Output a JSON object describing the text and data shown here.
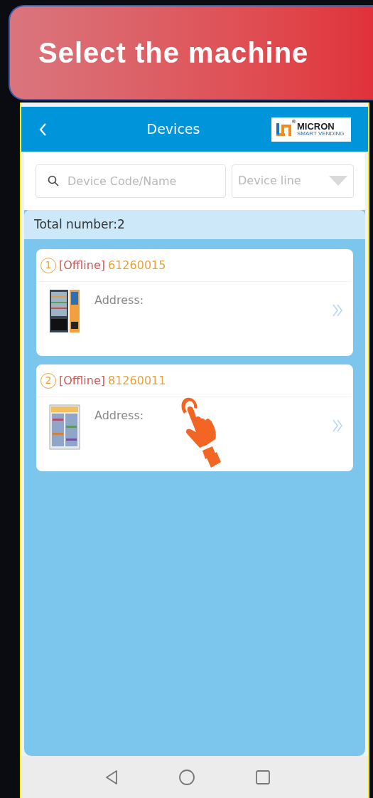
{
  "banner": {
    "title": "Select the machine"
  },
  "header": {
    "title": "Devices",
    "logo": {
      "brand": "MICRON",
      "tagline": "SMART VENDING",
      "mark": "®"
    }
  },
  "search": {
    "placeholder": "Device Code/Name"
  },
  "device_line": {
    "placeholder": "Device line"
  },
  "total": "Total number:2",
  "devices": [
    {
      "index": "1",
      "status": "[Offline]",
      "code": "61260015",
      "address_label": "Address:",
      "kind": "snack",
      "pointer": false
    },
    {
      "index": "2",
      "status": "[Offline]",
      "code": "81260011",
      "address_label": "Address:",
      "kind": "fridge",
      "pointer": true
    }
  ]
}
